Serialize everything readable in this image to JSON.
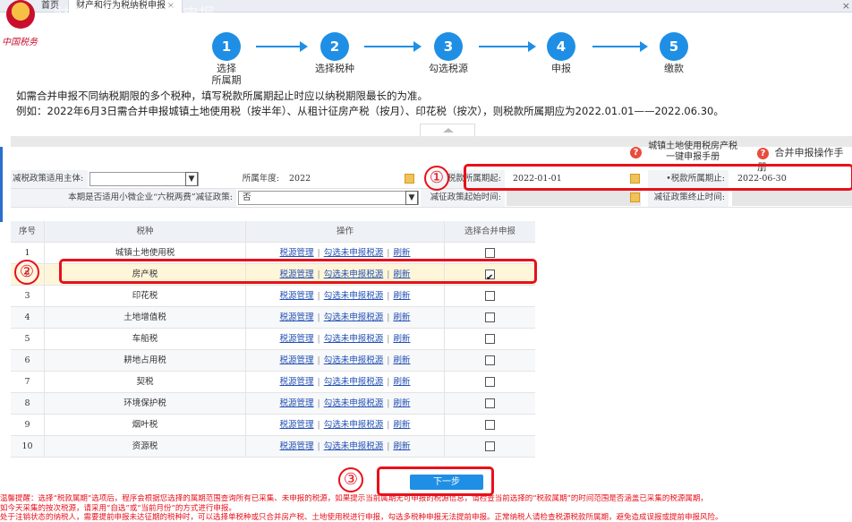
{
  "tabs": {
    "home": "首页",
    "active": "财产和行为税纳税申报",
    "close": "×"
  },
  "brand": "中国税务",
  "watermark": "财产和行为税纳税申报",
  "steps": [
    {
      "num": "1",
      "label": "选择\n所属期"
    },
    {
      "num": "2",
      "label": "选择税种"
    },
    {
      "num": "3",
      "label": "勾选税源"
    },
    {
      "num": "4",
      "label": "申报"
    },
    {
      "num": "5",
      "label": "缴款"
    }
  ],
  "notes": {
    "line1": "如需合并申报不同纳税期限的多个税种，填写税款所属期起止时应以纳税期限最长的为准。",
    "line2": "例如：2022年6月3日需合并申报城镇土地使用税（按半年）、从租计征房产税（按月）、印花税（按次），则税款所属期应为2022.01.01——2022.06.30。"
  },
  "help": {
    "manual1": "城镇土地使用税房产税\n一键申报手册",
    "manual2": "合并申报操作手册"
  },
  "form": {
    "subject_label": "减税政策适用主体:",
    "subject_value": "",
    "year_label": "所属年度:",
    "year_value": "2022",
    "start_label": "税款所属期起:",
    "start_value": "2022-01-01",
    "end_label": "•税款所属期止:",
    "end_value": "2022-06-30",
    "policy_label": "本期是否适用小微企业“六税两费”减征政策:",
    "policy_value": "否",
    "policy_start_label": "减征政策起始时间:",
    "policy_end_label": "减征政策终止时间:"
  },
  "table": {
    "headers": {
      "no": "序号",
      "tax": "税种",
      "op": "操作",
      "chk": "选择合并申报"
    },
    "links": {
      "manage": "税源管理",
      "pick": "勾选未申报税源",
      "refresh": "刷新",
      "sep": "|"
    },
    "rows": [
      {
        "no": "1",
        "tax": "城镇土地使用税",
        "checked": false
      },
      {
        "no": "2",
        "tax": "房产税",
        "checked": true
      },
      {
        "no": "3",
        "tax": "印花税",
        "checked": false
      },
      {
        "no": "4",
        "tax": "土地增值税",
        "checked": false
      },
      {
        "no": "5",
        "tax": "车船税",
        "checked": false
      },
      {
        "no": "6",
        "tax": "耕地占用税",
        "checked": false
      },
      {
        "no": "7",
        "tax": "契税",
        "checked": false
      },
      {
        "no": "8",
        "tax": "环境保护税",
        "checked": false
      },
      {
        "no": "9",
        "tax": "烟叶税",
        "checked": false
      },
      {
        "no": "10",
        "tax": "资源税",
        "checked": false
      }
    ]
  },
  "next_button": "下一步",
  "annotations": [
    "①",
    "②",
    "③"
  ],
  "tips": {
    "line1": "温馨提醒：选择“税款属期”选项后，程序会根据您选择的属期范围查询所有已采集、未申报的税源，如果提示当前属期无可申报的税源信息，请检查当前选择的“税款属期”的时间范围是否涵盖已采集的税源属期，",
    "line2": "如今天采集的按次税源，请采用“自选”或“当前月份”的方式进行申报。",
    "line3": "处于注销状态的纳税人，需要提前申报未达征期的税种时，可以选择单税种或只合并房产税、土地使用税进行申报，勾选多税种申报无法提前申报。正常纳税人请检查税源税款所属期，避免造成误报或提前申报风险。"
  },
  "colors": {
    "accent": "#1f8fe5",
    "annotation": "#e8101a",
    "link": "#2250b3"
  }
}
